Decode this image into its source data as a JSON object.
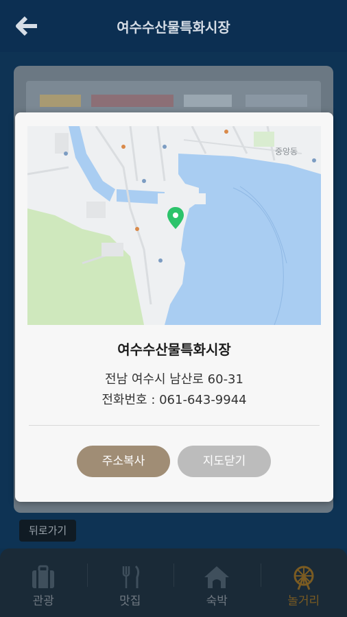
{
  "header": {
    "title": "여수수산물특화시장",
    "back_icon": "arrow-left-icon"
  },
  "background": {
    "back_button_label": "뒤로가기"
  },
  "bottom_nav": {
    "items": [
      {
        "label": "관광",
        "icon": "suitcase-icon",
        "active": false
      },
      {
        "label": "맛집",
        "icon": "fork-knife-icon",
        "active": false
      },
      {
        "label": "숙박",
        "icon": "house-icon",
        "active": false
      },
      {
        "label": "놀거리",
        "icon": "ferris-wheel-icon",
        "active": true
      }
    ]
  },
  "modal": {
    "place_name": "여수수산물특화시장",
    "address": "전남 여수시 남산로 60-31",
    "phone": "전화번호 : 061-643-9944",
    "copy_button": "주소복사",
    "close_button": "지도닫기",
    "map": {
      "district_label": "중앙동",
      "pin_color": "#2cc36b",
      "water_color": "#a9cdf2",
      "park_color": "#cfe8bd"
    }
  },
  "colors": {
    "header_bg": "#0c2f52",
    "copy_button": "#a08d75",
    "close_button": "#bcbcbc",
    "active_nav": "#7a5b22"
  }
}
